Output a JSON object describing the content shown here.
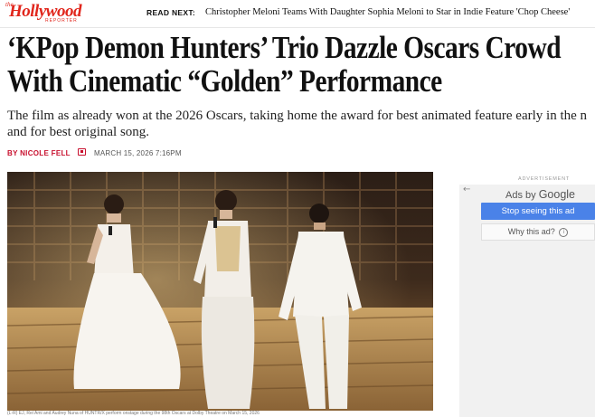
{
  "header": {
    "logo_the": "the",
    "logo_main": "Hollywood",
    "logo_sub": "REPORTER",
    "read_next_label": "READ NEXT:",
    "read_next_title": "Christopher Meloni Teams With Daughter Sophia Meloni to Star in Indie Feature 'Chop Cheese'"
  },
  "article": {
    "headline_line1": "‘KPop Demon Hunters’ Trio Dazzle Oscars Crowd",
    "headline_line2": "With Cinematic “Golden” Performance",
    "dek_line1": "The film as already won at the 2026 Oscars, taking home the award for best animated feature early in the n",
    "dek_line2": "and for best original song.",
    "byline": "BY NICOLE FELL",
    "date": "MARCH 15, 2026 7:16PM",
    "photo_caption": "(L-R) EJ, Rei Ami and Audrey Nuna of HUNTR/X perform onstage during the 98th Oscars at Dolby Theatre on March 15, 2026"
  },
  "ad": {
    "label": "ADVERTISEMENT",
    "back_icon": "←",
    "ads_by": "Ads by",
    "google": "Google",
    "stop_label": "Stop seeing this ad",
    "why_label": "Why this ad?",
    "info_icon": "i"
  },
  "colors": {
    "brand_red": "#e1261c",
    "byline_red": "#c8102e",
    "ad_blue": "#4a82e8"
  }
}
